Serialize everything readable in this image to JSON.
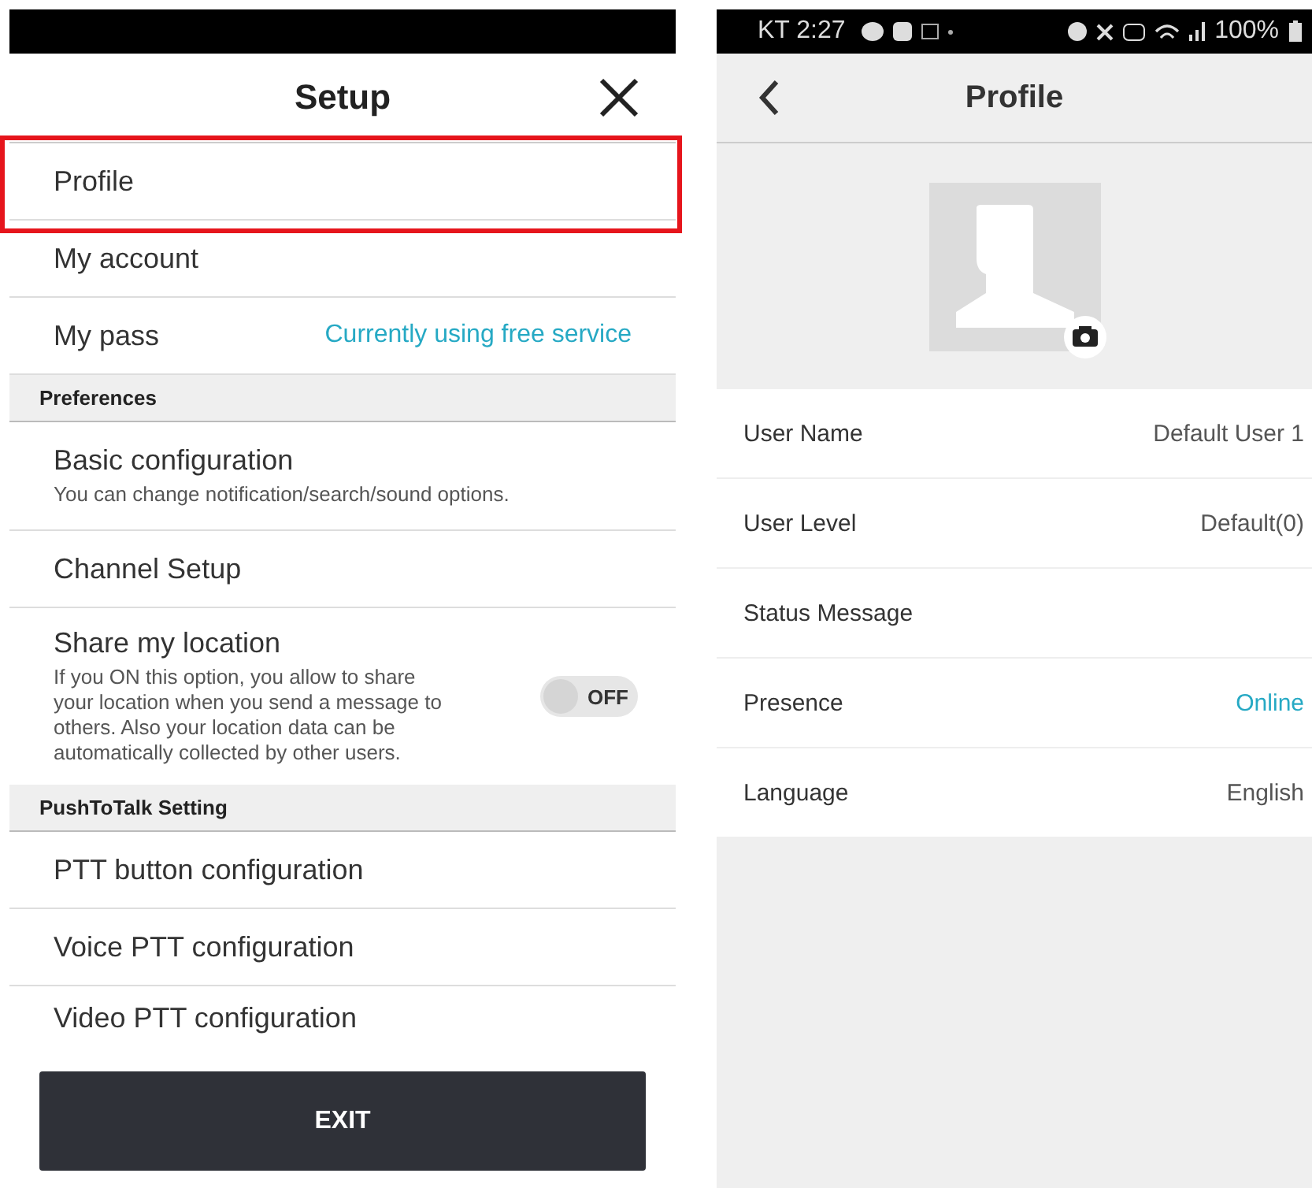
{
  "setup_screen": {
    "title": "Setup",
    "items": [
      {
        "kind": "nav",
        "label": "Profile",
        "highlighted": true
      },
      {
        "kind": "nav",
        "label": "My account",
        "highlighted": false
      },
      {
        "kind": "value",
        "label": "My pass",
        "value": "Currently using free service",
        "highlighted": false
      },
      {
        "kind": "section",
        "label": "Preferences"
      },
      {
        "kind": "described",
        "label": "Basic configuration",
        "description": "You can change notification/search/sound options.",
        "highlighted": false
      },
      {
        "kind": "nav",
        "label": "Channel Setup",
        "highlighted": false
      },
      {
        "kind": "toggle",
        "label": "Share my location",
        "description": "If you ON this option, you allow to share your location when you send a message to others. Also your location data can be automatically collected by other users.",
        "on": false,
        "toggle_label": "OFF",
        "highlighted": false
      },
      {
        "kind": "section",
        "label": "PushToTalk Setting"
      },
      {
        "kind": "nav",
        "label": "PTT button configuration",
        "highlighted": false
      },
      {
        "kind": "nav",
        "label": "Voice PTT configuration",
        "highlighted": false
      },
      {
        "kind": "cut",
        "label": "Video PTT configuration",
        "highlighted": false
      }
    ],
    "exit_button": "EXIT"
  },
  "profile_screen": {
    "status_bar": {
      "carrier_time": "KT 2:27",
      "battery": "100%"
    },
    "title": "Profile",
    "fields": [
      {
        "label": "User Name",
        "value": "Default User 1",
        "accent": false
      },
      {
        "label": "User Level",
        "value": "Default(0)",
        "accent": false
      },
      {
        "label": "Status Message",
        "accent": false
      },
      {
        "label": "Presence",
        "value": "Online",
        "accent": true
      },
      {
        "label": "Language",
        "value": "English",
        "accent": false
      }
    ]
  }
}
